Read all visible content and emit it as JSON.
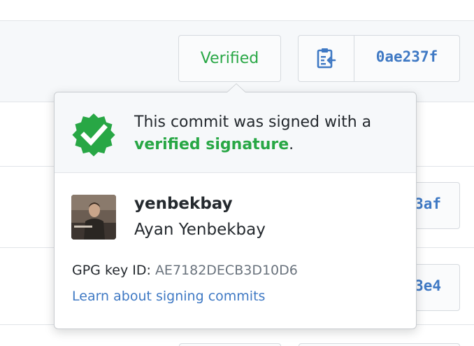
{
  "commit": {
    "verified_label": "Verified",
    "sha": "0ae237f",
    "clipboard_icon": "clipboard-icon"
  },
  "background_rows": [
    {
      "sha_partial": "3af"
    },
    {
      "sha_partial": "3e4"
    }
  ],
  "popover": {
    "badge_icon": "verified-badge-icon",
    "message_prefix": "This commit was signed with a",
    "message_strong": "verified signature",
    "message_suffix": ".",
    "user": {
      "login": "yenbekbay",
      "name": "Ayan Yenbekbay",
      "avatar_icon": "user-avatar"
    },
    "gpg_label": "GPG key ID:",
    "gpg_key": "AE7182DECB3D10D6",
    "learn_link": "Learn about signing commits"
  },
  "colors": {
    "verified_green": "#28a745",
    "link_blue": "#3f79c4",
    "header_bg": "#f6f8fa"
  }
}
